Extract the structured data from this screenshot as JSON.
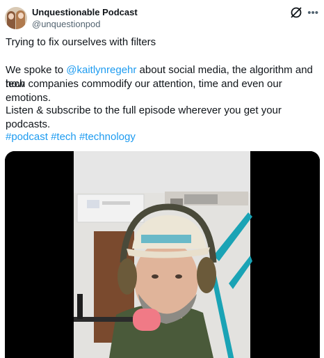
{
  "author": {
    "name": "Unquestionable Podcast",
    "handle": "@unquestionpod"
  },
  "icons": {
    "avatar": "avatar-image",
    "grok": "grok-icon",
    "more": "more-options-icon"
  },
  "tweet": {
    "line1": "Trying to fix ourselves with filters",
    "line2_prefix": "We spoke to ",
    "mention": "@kaitlynregehr",
    "line2_suffix": " about social media, the algorithm and how",
    "line3": "tech companies commodify our attention, time and even our emotions.",
    "line4": "Listen & subscribe to the full episode wherever you get your podcasts.",
    "hashtags": [
      "#podcast",
      "#tech",
      "#technology"
    ]
  },
  "colors": {
    "link": "#1d9bf0",
    "secondary_text": "#536471"
  }
}
